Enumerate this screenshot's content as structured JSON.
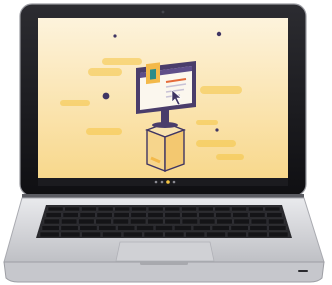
{
  "colors": {
    "page_background": "#ffffff",
    "bezel": "#17171b",
    "screen_top": "#fdf1d6",
    "screen_bottom": "#f8d98d",
    "accent_stripe": "#f5c542",
    "monitor_frame": "#4a3d6b",
    "monitor_screen": "#fbf7ee",
    "monitor_header": "#5e4e8a",
    "accent_orange": "#e56b3a",
    "accent_teal": "#2a8c8a",
    "accent_yellow": "#f3b94a",
    "pedestal_line": "#3f3563",
    "base_aluminum": "#d7d8dc",
    "keyboard_well": "#2a2a2e",
    "key": "#1d1d21",
    "key_edge": "#3a3a40"
  },
  "icons": {
    "laptop": "laptop-icon",
    "monitor": "monitor-icon",
    "cursor": "cursor-arrow-icon",
    "pedestal": "pedestal-icon",
    "pagination_dots": "carousel-dots-icon"
  },
  "slideshow": {
    "dot_count": 4,
    "active_dot": 2
  }
}
